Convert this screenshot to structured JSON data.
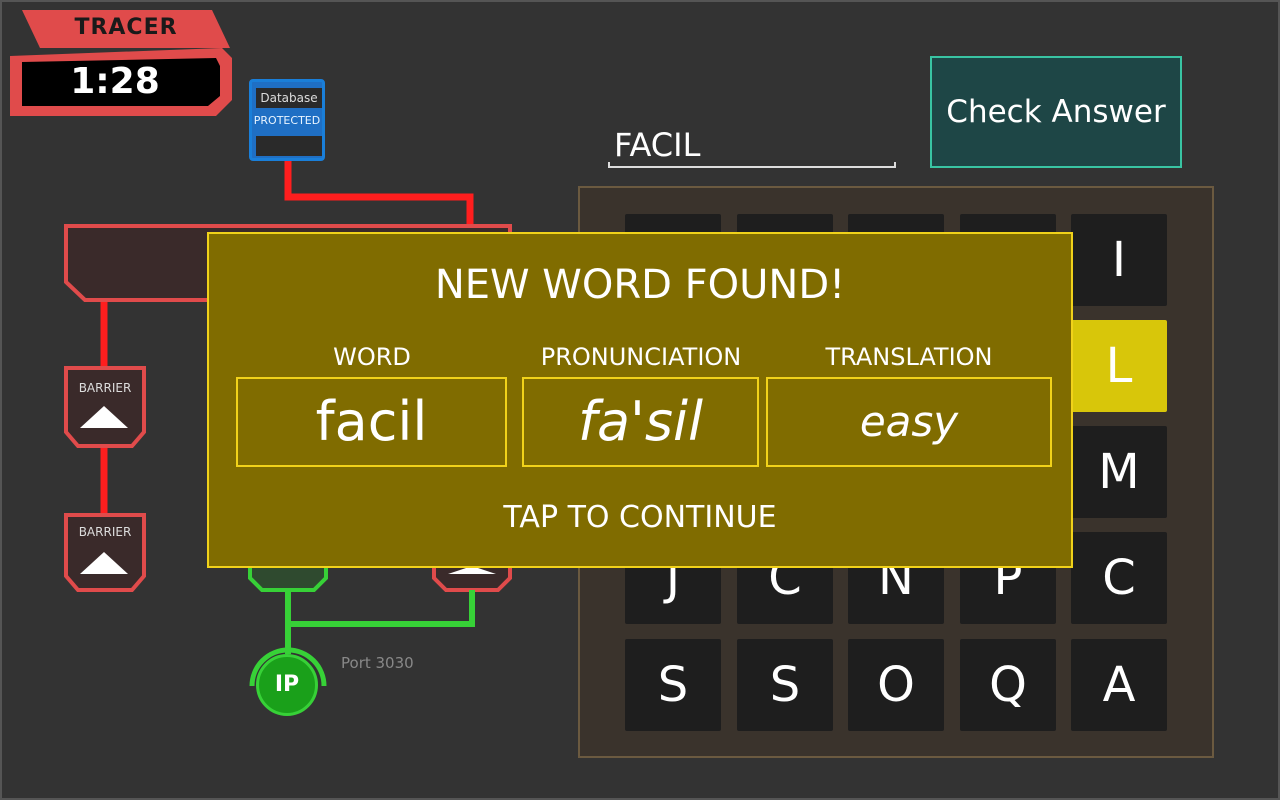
{
  "hud": {
    "tracer_label": "TRACER",
    "timer": "1:28"
  },
  "network": {
    "database": {
      "title": "Database",
      "status": "PROTECTED"
    },
    "barriers": [
      {
        "label": "BARRIER"
      },
      {
        "label": "BARRIER"
      }
    ],
    "ip_node": {
      "label": "IP",
      "port": "Port 3030"
    }
  },
  "answer": {
    "current": "FACIL",
    "check_button": "Check Answer"
  },
  "grid": {
    "visible_tiles": [
      "I",
      "L",
      "M",
      "J",
      "C",
      "N",
      "P",
      "C",
      "S",
      "S",
      "O",
      "Q",
      "A"
    ],
    "selected": "L"
  },
  "modal": {
    "title": "NEW WORD FOUND!",
    "headers": {
      "word": "WORD",
      "pronunciation": "PRONUNCIATION",
      "translation": "TRANSLATION"
    },
    "word": "facil",
    "pronunciation": "fa'sil",
    "translation": "easy",
    "footer": "TAP TO CONTINUE"
  },
  "colors": {
    "background": "#333333",
    "alert_red": "#e04b4b",
    "database_blue": "#1f6fc4",
    "ip_green": "#1aa01a",
    "modal_bg": "#806c00",
    "modal_border": "#f1d21a",
    "selected_tile": "#d8c60a",
    "check_button_border": "#39c4a3"
  }
}
